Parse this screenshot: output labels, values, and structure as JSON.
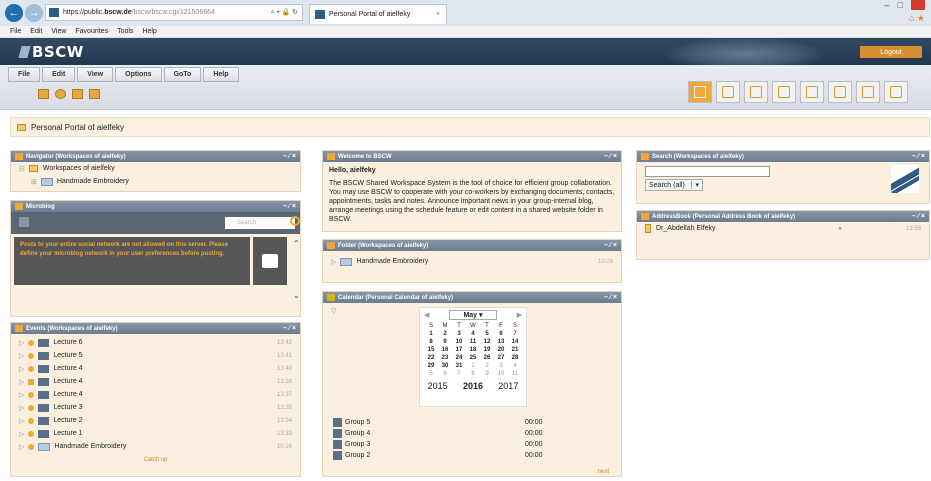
{
  "browser": {
    "url_prefix": "https://public.",
    "url_host": "bscw.de",
    "url_path": "/bscw/bscw.cgi/121506664",
    "url_controls": "⌕ ▾ 🔒 ↻",
    "tab_title": "Personal Portal of aielfeky",
    "tab_close": "×",
    "menu": [
      "File",
      "Edit",
      "View",
      "Favourites",
      "Tools",
      "Help"
    ]
  },
  "app": {
    "logo": "BSCW",
    "logout": "Logout",
    "menu": [
      "File",
      "Edit",
      "View",
      "Options",
      "GoTo",
      "Help"
    ]
  },
  "portal_title": "Personal Portal of aielfeky",
  "navigator": {
    "title": "Navigator (Workspaces of aielfeky)",
    "items": [
      "Workspaces of aielfeky",
      "Handmade Embroidery"
    ]
  },
  "microblog": {
    "title": "Microblog",
    "search_placeholder": "Search",
    "message": "Posts to your entire social network are not allowed on this server. Please define your microblog network in your user preferences before posting."
  },
  "events": {
    "title": "Events (Workspaces of aielfeky)",
    "items": [
      {
        "name": "Lecture 6",
        "time": "13:42"
      },
      {
        "name": "Lecture 5",
        "time": "13:41"
      },
      {
        "name": "Lecture 4",
        "time": "13:40"
      },
      {
        "name": "Lecture 4",
        "time": "13:38"
      },
      {
        "name": "Lecture 4",
        "time": "13:37"
      },
      {
        "name": "Lecture 3",
        "time": "13:35"
      },
      {
        "name": "Lecture 2",
        "time": "13:34"
      },
      {
        "name": "Lecture 1",
        "time": "13:33"
      },
      {
        "name": "Handmade Embroidery",
        "time": "10:26"
      }
    ],
    "catch_up": "Catch up"
  },
  "welcome": {
    "title": "Welcome to BSCW",
    "greeting": "Hello, aielfeky",
    "body": "The BSCW Shared Workspace System is the tool of choice for efficient group collaboration. You may use BSCW to cooperate with your co-workers by exchanging documents, contacts, appointments, tasks and notes. Announce important news in your group-internal blog, arrange meetings using the schedule feature or edit content in a shared website folder in BSCW."
  },
  "folder": {
    "title": "Folder (Workspaces of aielfeky)",
    "item": "Handmade Embroidery",
    "time": "10:26"
  },
  "calendar": {
    "title": "Calendar (Personal Calendar of aielfeky)",
    "month": "May",
    "weekdays": [
      "S",
      "M",
      "T",
      "W",
      "T",
      "F",
      "S"
    ],
    "days": [
      "1",
      "2",
      "3",
      "4",
      "5",
      "6",
      "7",
      "8",
      "9",
      "10",
      "11",
      "12",
      "13",
      "14",
      "15",
      "16",
      "17",
      "18",
      "19",
      "20",
      "21",
      "22",
      "23",
      "24",
      "25",
      "26",
      "27",
      "28",
      "29",
      "30",
      "31",
      "1",
      "2",
      "3",
      "4",
      "5",
      "6",
      "7",
      "8",
      "9",
      "10",
      "11"
    ],
    "years": [
      "2015",
      "2016",
      "2017"
    ],
    "groups": [
      {
        "name": "Group 5",
        "time": "00:00"
      },
      {
        "name": "Group 4",
        "time": "00:00"
      },
      {
        "name": "Group 3",
        "time": "00:00"
      },
      {
        "name": "Group 2",
        "time": "00:00"
      }
    ],
    "next": "next"
  },
  "search": {
    "title": "Search (Workspaces of aielfeky)",
    "button": "Search (all)"
  },
  "addressbook": {
    "title": "AddressBook (Personal Address Book of aielfeky)",
    "entry": "Dr_Abdellah Elfeky",
    "time": "13:58"
  },
  "widget_controls": "– ∕ ×",
  "colors": {
    "accent": "#f0a73a",
    "header": "#22384f",
    "widget_bg": "#fbf0df"
  }
}
